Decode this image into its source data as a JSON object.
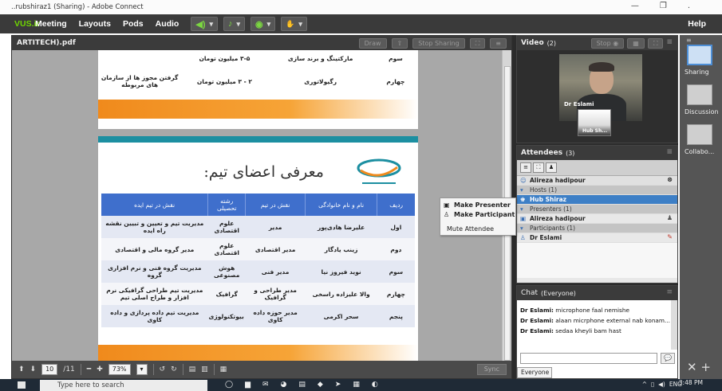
{
  "window": {
    "title": "..rubshiraz1 (Sharing) - Adobe Connect",
    "minimize": "—",
    "restore": "❐",
    "close": "."
  },
  "menubar": {
    "logo": "VUS.ir",
    "items": [
      "Meeting",
      "Layouts",
      "Pods",
      "Audio"
    ],
    "help": "Help"
  },
  "share_pod": {
    "title": "ARTITECH).pdf",
    "draw_label": "Draw",
    "stop_sharing_label": "Stop Sharing",
    "page1_table": [
      [
        "سوم",
        "مارکتینگ و برند سازی",
        "۳-۵ میلیون تومان",
        ""
      ],
      [
        "چهارم",
        "رگیولاتوری",
        "۲ - ۳ میلیون تومان",
        "گرفتن مجوز ها از سازمان های مربوطه"
      ]
    ],
    "team_title": "معرفی اعضای تیم:",
    "team_headers": [
      "ردیف",
      "نام و نام خانوادگی",
      "نقش در تیم",
      "رشته تحصیلی",
      "نقش در تیم ایده"
    ],
    "team_rows": [
      [
        "اول",
        "علیرضا هادی‌پور",
        "مدیر",
        "علوم اقتصادی",
        "مدیریت تیم و تعیین و تبیین نقشه راه ایده"
      ],
      [
        "دوم",
        "زینب یادگار",
        "مدیر اقتصادی",
        "علوم اقتصادی",
        "مدیر گروه مالی و اقتصادی"
      ],
      [
        "سوم",
        "نوید فیروز نیا",
        "مدیر فنی",
        "هوش مصنوعی",
        "مدیریت گروه فنی و نرم افزاری گروه"
      ],
      [
        "چهارم",
        "والا علیزاده راسخی",
        "مدیر طراحی و گرافیک",
        "گرافیک",
        "مدیریت تیم طراحی گرافیکی نرم افزار و طراح اصلی تیم"
      ],
      [
        "پنجم",
        "سحر اکرمی",
        "مدیر حوزه داده کاوی",
        "بیوتکنولوژی",
        "مدیریت تیم داده پردازی و داده کاوی"
      ]
    ],
    "bottom": {
      "page_current": "10",
      "page_total": "/11",
      "zoom": "73%",
      "sync_label": "Sync"
    }
  },
  "video_pod": {
    "title": "Video",
    "count": "(2)",
    "stop_label": "Stop",
    "main_name": "Dr Eslami",
    "thumb_name": "Hub Sh..."
  },
  "attendees_pod": {
    "title": "Attendees",
    "count": "(3)",
    "me": "Alireza hadipour",
    "hosts_label": "Hosts (1)",
    "host_name": "Hub Shiraz",
    "presenters_label": "Presenters (1)",
    "presenter_name": "Alireza hadipour",
    "participants_label": "Participants (1)",
    "participant_name": "Dr Eslami"
  },
  "context_menu": {
    "make_presenter": "Make Presenter",
    "make_participant": "Make Participant",
    "mute_attendee": "Mute Attendee"
  },
  "chat_pod": {
    "title": "Chat",
    "scope": "(Everyone)",
    "messages": [
      {
        "sender": "Dr Eslami:",
        "text": " microphone faal nemishe"
      },
      {
        "sender": "Dr Eslami:",
        "text": " alaan micrphone external nab konam..."
      },
      {
        "sender": "Dr Eslami:",
        "text": " sedaa kheyli bam hast"
      }
    ],
    "tab_label": "Everyone"
  },
  "layouts_panel": {
    "items": [
      "Sharing",
      "Discussion",
      "Collabo..."
    ]
  },
  "taskbar": {
    "search_placeholder": "Type here to search",
    "clock": "3:48 PM",
    "lang": "ENG"
  },
  "colors": {
    "header_blue": "#3f6fcc",
    "orange": "#f08a1c",
    "teal": "#1c8fa1",
    "vus_green": "#6fd600"
  }
}
